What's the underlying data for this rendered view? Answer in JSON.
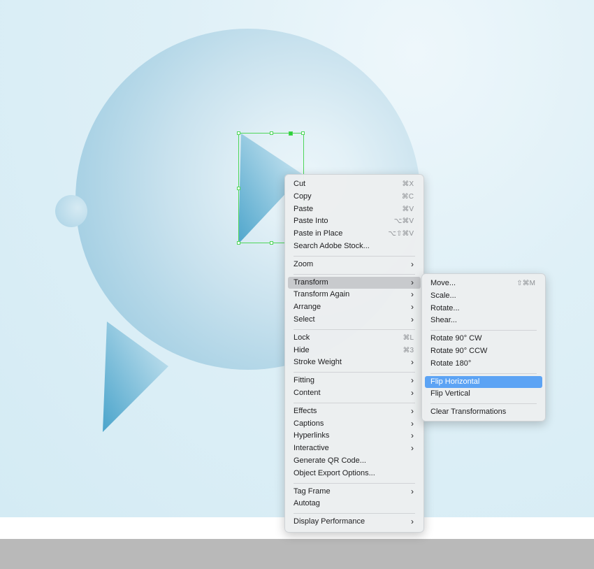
{
  "menu": {
    "groups": [
      [
        {
          "label": "Cut",
          "shortcut": "⌘X"
        },
        {
          "label": "Copy",
          "shortcut": "⌘C"
        },
        {
          "label": "Paste",
          "shortcut": "⌘V"
        },
        {
          "label": "Paste Into",
          "shortcut": "⌥⌘V"
        },
        {
          "label": "Paste in Place",
          "shortcut": "⌥⇧⌘V"
        },
        {
          "label": "Search Adobe Stock..."
        }
      ],
      [
        {
          "label": "Zoom",
          "submenu": true
        }
      ],
      [
        {
          "label": "Transform",
          "submenu": true,
          "highlight": "gray"
        },
        {
          "label": "Transform Again",
          "submenu": true
        },
        {
          "label": "Arrange",
          "submenu": true
        },
        {
          "label": "Select",
          "submenu": true
        }
      ],
      [
        {
          "label": "Lock",
          "shortcut": "⌘L"
        },
        {
          "label": "Hide",
          "shortcut": "⌘3"
        },
        {
          "label": "Stroke Weight",
          "submenu": true
        }
      ],
      [
        {
          "label": "Fitting",
          "submenu": true
        },
        {
          "label": "Content",
          "submenu": true
        }
      ],
      [
        {
          "label": "Effects",
          "submenu": true
        },
        {
          "label": "Captions",
          "submenu": true
        },
        {
          "label": "Hyperlinks",
          "submenu": true
        },
        {
          "label": "Interactive",
          "submenu": true
        },
        {
          "label": "Generate QR Code..."
        },
        {
          "label": "Object Export Options..."
        }
      ],
      [
        {
          "label": "Tag Frame",
          "submenu": true
        },
        {
          "label": "Autotag"
        }
      ],
      [
        {
          "label": "Display Performance",
          "submenu": true
        }
      ]
    ]
  },
  "submenu": {
    "groups": [
      [
        {
          "label": "Move...",
          "shortcut": "⇧⌘M"
        },
        {
          "label": "Scale..."
        },
        {
          "label": "Rotate..."
        },
        {
          "label": "Shear..."
        }
      ],
      [
        {
          "label": "Rotate 90° CW"
        },
        {
          "label": "Rotate 90° CCW"
        },
        {
          "label": "Rotate 180°"
        }
      ],
      [
        {
          "label": "Flip Horizontal",
          "highlight": "blue"
        },
        {
          "label": "Flip Vertical"
        }
      ],
      [
        {
          "label": "Clear Transformations"
        }
      ]
    ]
  },
  "icons": {
    "submenu_arrow": "chevron-right-icon",
    "arrow_glyph": "›"
  },
  "colors": {
    "selection": "#4fd65a",
    "highlight_blue": "#5ca3f4",
    "highlight_gray": "#c8cacd"
  }
}
